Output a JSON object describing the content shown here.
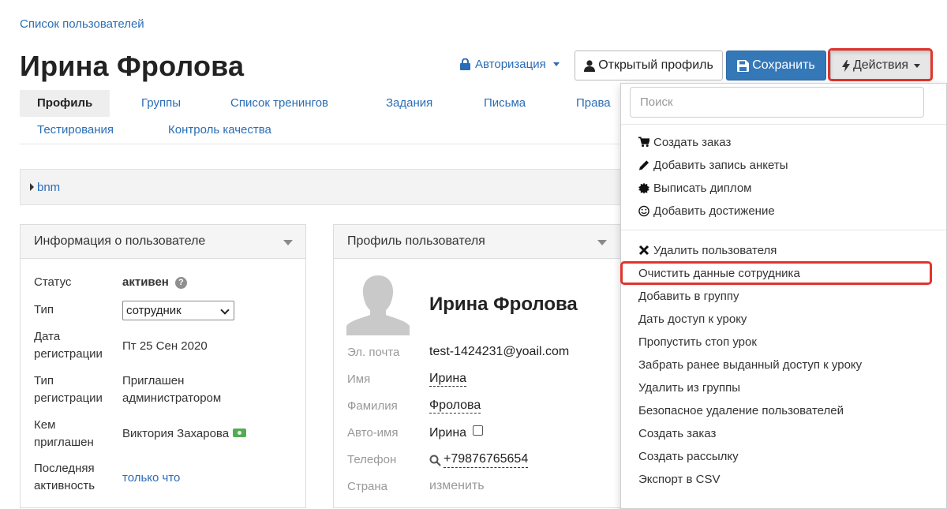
{
  "breadcrumb": "Список пользователей",
  "page_title": "Ирина Фролова",
  "header_actions": {
    "authorization": "Авторизация",
    "open_profile": "Открытый профиль",
    "save": "Сохранить",
    "actions": "Действия"
  },
  "tabs": [
    {
      "label": "Профиль",
      "active": true
    },
    {
      "label": "Группы"
    },
    {
      "label": "Список тренингов"
    },
    {
      "label": "Задания"
    },
    {
      "label": "Письма"
    },
    {
      "label": "Права"
    },
    {
      "label": "Тестирования"
    },
    {
      "label": "Контроль качества"
    }
  ],
  "collapsible": {
    "label": "bnm"
  },
  "user_info": {
    "title": "Информация о пользователе",
    "status_label": "Статус",
    "status_value": "активен",
    "type_label": "Тип",
    "type_value": "сотрудник",
    "reg_date_label_1": "Дата",
    "reg_date_label_2": "регистрации",
    "reg_date_value": "Пт 25 Сен 2020",
    "reg_type_label_1": "Тип",
    "reg_type_label_2": "регистрации",
    "reg_type_value_1": "Приглашен",
    "reg_type_value_2": "администратором",
    "invited_label_1": "Кем",
    "invited_label_2": "приглашен",
    "invited_value": "Виктория Захарова",
    "last_activity_label_1": "Последняя",
    "last_activity_label_2": "активность",
    "last_activity_value": "только что"
  },
  "profile": {
    "title": "Профиль пользователя",
    "name": "Ирина Фролова",
    "email_label": "Эл. почта",
    "email_value": "test-1424231@yoail.com",
    "first_name_label": "Имя",
    "first_name_value": "Ирина",
    "last_name_label": "Фамилия",
    "last_name_value": "Фролова",
    "auto_name_label": "Авто-имя",
    "auto_name_value": "Ирина",
    "phone_label": "Телефон",
    "phone_value": "+79876765654",
    "country_label": "Страна",
    "country_value": "изменить"
  },
  "actions_menu": {
    "search_placeholder": "Поиск",
    "group1": [
      {
        "label": "Создать заказ",
        "icon": "cart-icon"
      },
      {
        "label": "Добавить запись анкеты",
        "icon": "pencil-icon"
      },
      {
        "label": "Выписать диплом",
        "icon": "certificate-icon"
      },
      {
        "label": "Добавить достижение",
        "icon": "smile-icon"
      }
    ],
    "group2": [
      {
        "label": "Удалить пользователя",
        "icon": "x-icon"
      },
      {
        "label": "Очистить данные сотрудника"
      },
      {
        "label": "Добавить в группу"
      },
      {
        "label": "Дать доступ к уроку"
      },
      {
        "label": "Пропустить стоп урок"
      },
      {
        "label": "Забрать ранее выданный доступ к уроку"
      },
      {
        "label": "Удалить из группы"
      },
      {
        "label": "Безопасное удаление пользователей"
      },
      {
        "label": "Создать заказ"
      },
      {
        "label": "Создать рассылку"
      },
      {
        "label": "Экспорт в CSV"
      }
    ]
  },
  "colors": {
    "link": "#2a6db5",
    "primary": "#3478b8",
    "highlight": "#e0342d"
  }
}
